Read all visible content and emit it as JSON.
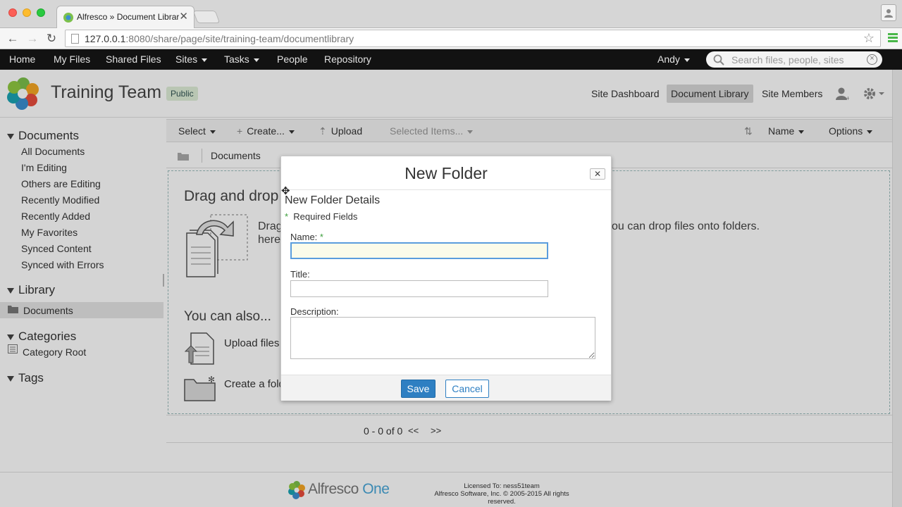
{
  "browser": {
    "tab_title": "Alfresco » Document Library",
    "tab_close": "✕",
    "url_host": "127.0.0.1",
    "url_rest": ":8080/share/page/site/training-team/documentlibrary",
    "back": "←",
    "forward": "→",
    "reload": "↻",
    "star": "☆"
  },
  "appbar": {
    "items": [
      "Home",
      "My Files",
      "Shared Files",
      "Sites",
      "Tasks",
      "People",
      "Repository"
    ],
    "user": "Andy",
    "search_placeholder": "Search files, people, sites",
    "search_clear": "×"
  },
  "site": {
    "title": "Training Team",
    "visibility": "Public",
    "nav": [
      "Site Dashboard",
      "Document Library",
      "Site Members"
    ]
  },
  "sidebar": {
    "documents_header": "Documents",
    "documents_items": [
      "All Documents",
      "I'm Editing",
      "Others are Editing",
      "Recently Modified",
      "Recently Added",
      "My Favorites",
      "Synced Content",
      "Synced with Errors"
    ],
    "library_header": "Library",
    "library_items": [
      "Documents"
    ],
    "categories_header": "Categories",
    "categories_items": [
      "Category Root"
    ],
    "tags_header": "Tags"
  },
  "doc_toolbar": {
    "select": "Select",
    "create": "Create...",
    "upload": "Upload",
    "selected_items": "Selected Items...",
    "sort": "Name",
    "options": "Options"
  },
  "breadcrumb": {
    "current": "Documents"
  },
  "dropzone": {
    "title": "Drag and drop",
    "text_line1": "Drag",
    "text_line2": "here",
    "text_right": "you can drop files onto folders.",
    "also": "You can also...",
    "upload_files": "Upload files",
    "create_folder": "Create a fold"
  },
  "pager": {
    "range": "0 - 0 of 0",
    "prev": "<<",
    "next": ">>"
  },
  "footer": {
    "brand_a": "Alfresco",
    "brand_b": "One",
    "licensed": "Licensed To: ness51team",
    "copyright": "Alfresco Software, Inc. © 2005-2015 All rights reserved."
  },
  "dialog": {
    "title": "New Folder",
    "close": "✕",
    "move_cursor": "✥",
    "subtitle": "New Folder Details",
    "required_star": "*",
    "required_text": "Required Fields",
    "name_label": "Name:",
    "name_value": "",
    "title_label": "Title:",
    "title_value": "",
    "description_label": "Description:",
    "description_value": "",
    "save": "Save",
    "cancel": "Cancel"
  }
}
